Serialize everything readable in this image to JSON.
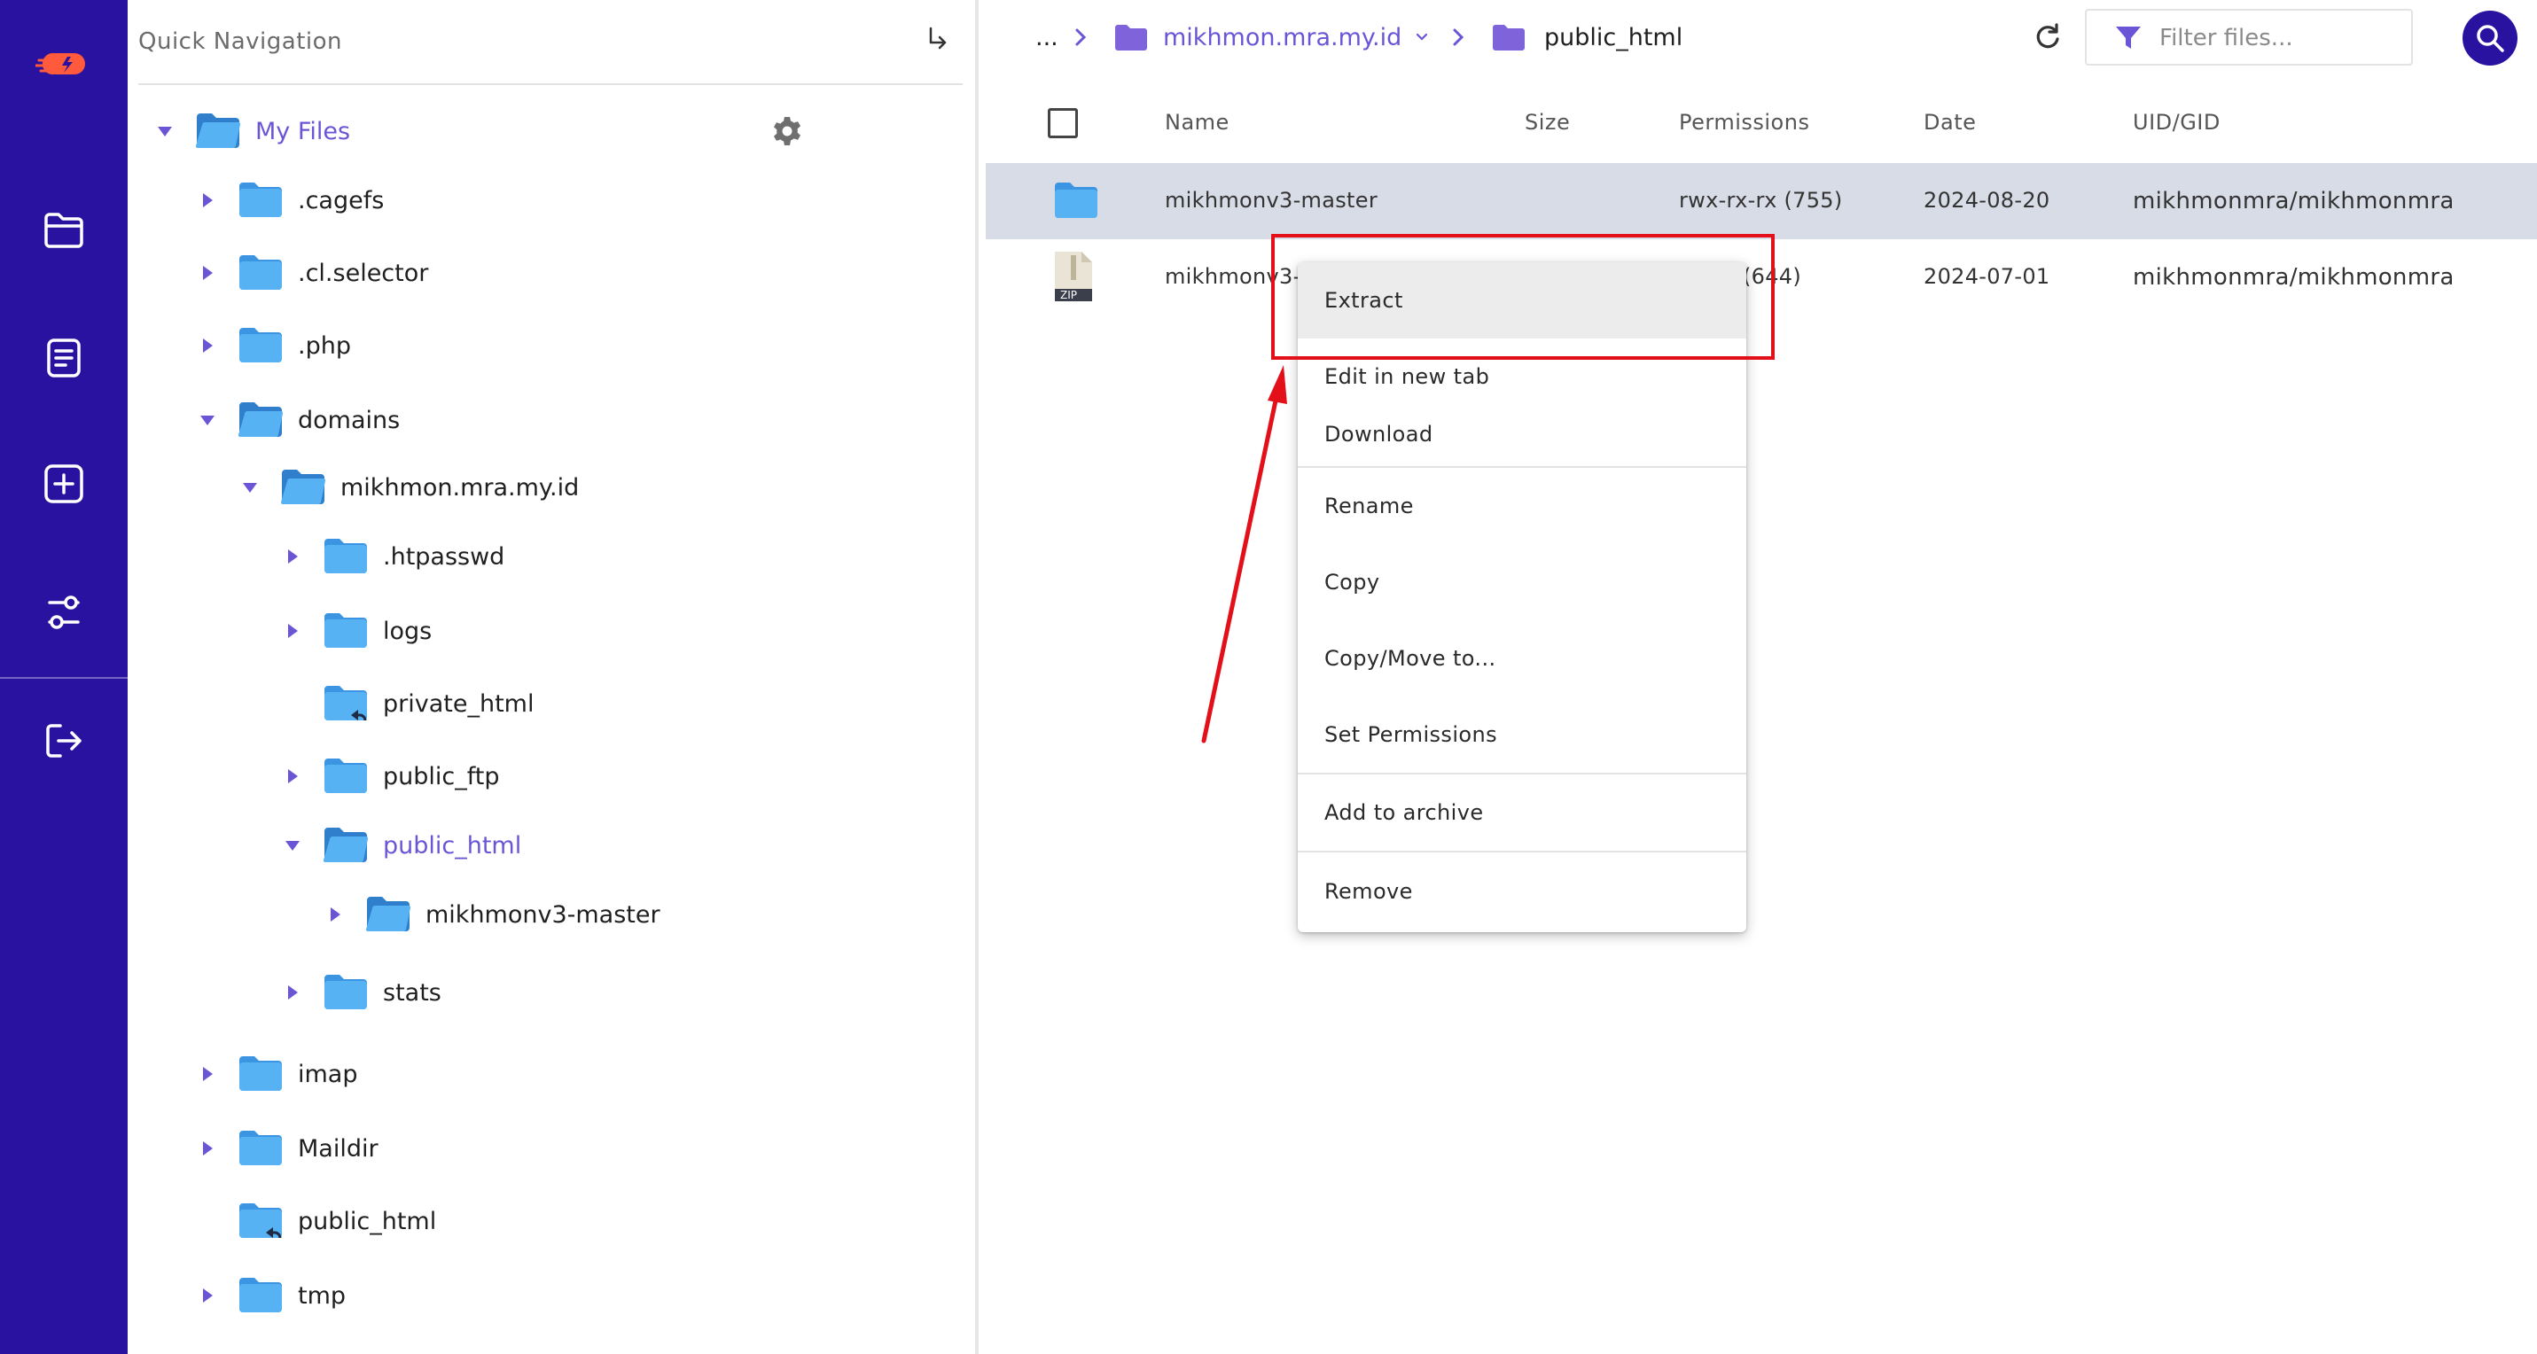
{
  "rail": {
    "buttons": [
      "logo-icon",
      "folder-icon",
      "document-icon",
      "add-icon",
      "settings-sliders-icon",
      "logout-icon"
    ]
  },
  "tree": {
    "title": "Quick Navigation",
    "root": "My Files",
    "nodes": [
      {
        "label": ".cagefs"
      },
      {
        "label": ".cl.selector"
      },
      {
        "label": ".php"
      },
      {
        "label": "domains"
      },
      {
        "label": "mikhmon.mra.my.id"
      },
      {
        "label": ".htpasswd"
      },
      {
        "label": "logs"
      },
      {
        "label": "private_html"
      },
      {
        "label": "public_ftp"
      },
      {
        "label": "public_html"
      },
      {
        "label": "mikhmonv3-master"
      },
      {
        "label": "stats"
      },
      {
        "label": "imap"
      },
      {
        "label": "Maildir"
      },
      {
        "label": "public_html"
      },
      {
        "label": "tmp"
      }
    ]
  },
  "header": {
    "ellipsis": "...",
    "crumb1": "mikhmon.mra.my.id",
    "crumb2": "public_html",
    "filter_placeholder": "Filter files..."
  },
  "table": {
    "columns": [
      "Name",
      "Size",
      "Permissions",
      "Date",
      "UID/GID"
    ],
    "rows": [
      {
        "name": "mikhmonv3-master",
        "size": "",
        "permissions": "rwx-rx-rx (755)",
        "date": "2024-08-20",
        "uid": "mikhmonmra/mikhmonmra"
      },
      {
        "name": "mikhmonv3-m",
        "size": "",
        "permissions": "(644)",
        "date": "2024-07-01",
        "uid": "mikhmonmra/mikhmonmra",
        "badge": "ZIP"
      }
    ]
  },
  "menu": {
    "items": [
      "Extract",
      "Edit in new tab",
      "Download",
      "Rename",
      "Copy",
      "Copy/Move to...",
      "Set Permissions",
      "Add to archive",
      "Remove"
    ]
  },
  "colors": {
    "rail": "#2a12a0",
    "accent": "#6b55d6",
    "folder": "#4ea7ee",
    "highlight": "#e3101a"
  }
}
